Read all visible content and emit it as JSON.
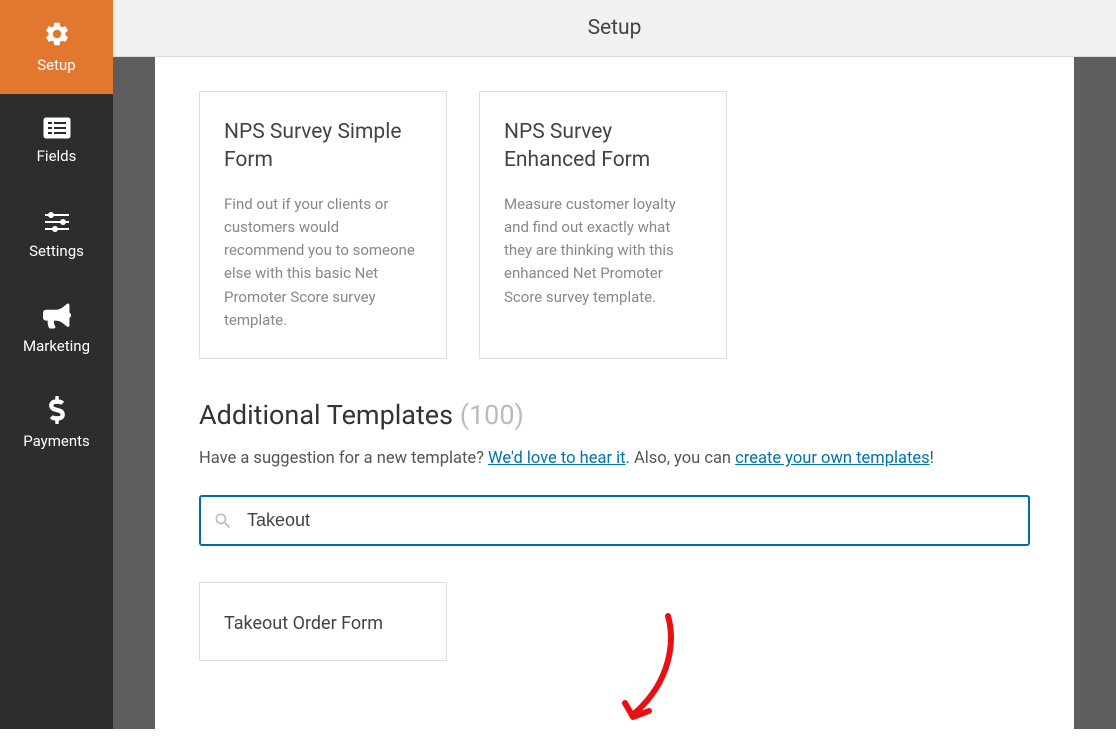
{
  "header": {
    "title": "Setup"
  },
  "sidebar": {
    "items": [
      {
        "label": "Setup",
        "icon": "gear"
      },
      {
        "label": "Fields",
        "icon": "list"
      },
      {
        "label": "Settings",
        "icon": "sliders"
      },
      {
        "label": "Marketing",
        "icon": "bullhorn"
      },
      {
        "label": "Payments",
        "icon": "dollar"
      }
    ]
  },
  "templates": [
    {
      "title": "NPS Survey Simple Form",
      "desc": "Find out if your clients or customers would recommend you to someone else with this basic Net Promoter Score survey template."
    },
    {
      "title": "NPS Survey Enhanced Form",
      "desc": "Measure customer loyalty and find out exactly what they are thinking with this enhanced Net Promoter Score survey template."
    }
  ],
  "additional": {
    "heading": "Additional Templates",
    "count": "(100)",
    "text_prefix": "Have a suggestion for a new template? ",
    "link1": "We'd love to hear it",
    "text_mid": ". Also, you can ",
    "link2": "create your own templates",
    "text_suffix": "!"
  },
  "search": {
    "value": "Takeout"
  },
  "result": {
    "title": "Takeout Order Form"
  }
}
